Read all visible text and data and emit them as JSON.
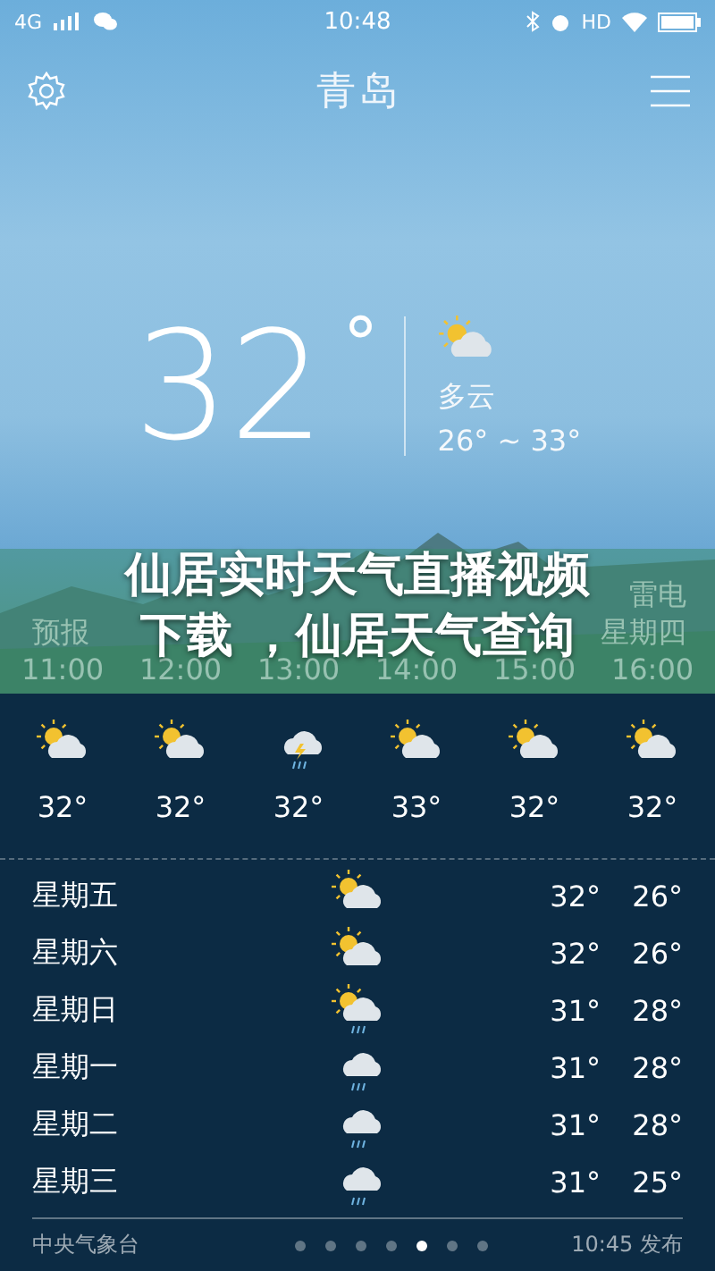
{
  "status_bar": {
    "network": "4G",
    "time": "10:48",
    "hd": "HD"
  },
  "header": {
    "city": "青岛"
  },
  "current": {
    "temp": "32",
    "degree": "°",
    "kind": "partly_cloudy",
    "condition": "多云",
    "range": "26° ~ 33°"
  },
  "forecast_labels": {
    "left": "预报",
    "right_top": "雷电",
    "right": "星期四"
  },
  "hourly": [
    {
      "time": "11:00",
      "kind": "partly_cloudy",
      "temp": "32°"
    },
    {
      "time": "12:00",
      "kind": "partly_cloudy",
      "temp": "32°"
    },
    {
      "time": "13:00",
      "kind": "thunder",
      "temp": "32°"
    },
    {
      "time": "14:00",
      "kind": "partly_cloudy",
      "temp": "33°"
    },
    {
      "time": "15:00",
      "kind": "partly_cloudy",
      "temp": "32°"
    },
    {
      "time": "16:00",
      "kind": "partly_cloudy",
      "temp": "32°"
    }
  ],
  "overlay_title": [
    "仙居实时天气直播视频",
    "下载 ，仙居天气查询"
  ],
  "daily": [
    {
      "day": "星期五",
      "kind": "partly_cloudy",
      "high": "32°",
      "low": "26°"
    },
    {
      "day": "星期六",
      "kind": "partly_cloudy",
      "high": "32°",
      "low": "26°"
    },
    {
      "day": "星期日",
      "kind": "partly_cloudy_rain",
      "high": "31°",
      "low": "28°"
    },
    {
      "day": "星期一",
      "kind": "rain",
      "high": "31°",
      "low": "28°"
    },
    {
      "day": "星期二",
      "kind": "rain",
      "high": "31°",
      "low": "28°"
    },
    {
      "day": "星期三",
      "kind": "rain",
      "high": "31°",
      "low": "25°"
    }
  ],
  "footer": {
    "source": "中央气象台",
    "pages": [
      {
        "selected": false
      },
      {
        "selected": false
      },
      {
        "selected": false
      },
      {
        "selected": false
      },
      {
        "selected": true
      },
      {
        "selected": false
      },
      {
        "selected": false
      }
    ],
    "published": "10:45 发布"
  }
}
